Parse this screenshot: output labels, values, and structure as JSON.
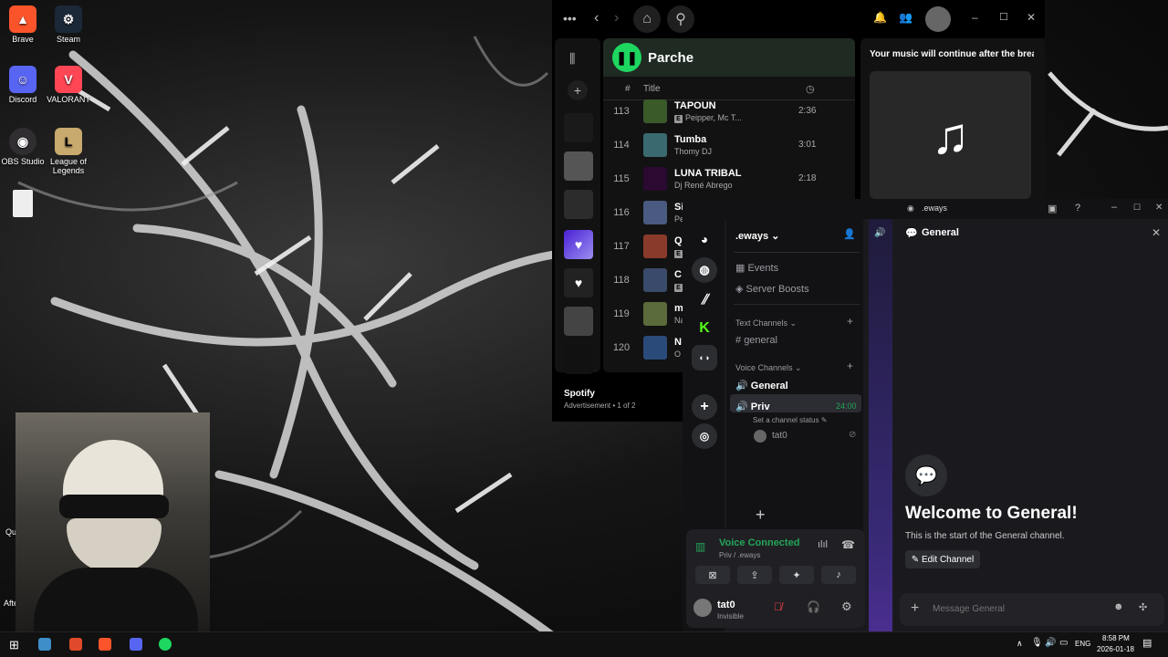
{
  "desktop": {
    "icons": [
      {
        "label": "Brave",
        "icon": "brave-icon",
        "color": "#fb542b"
      },
      {
        "label": "Steam",
        "icon": "steam-icon",
        "color": "#1b2838"
      },
      {
        "label": "Discord",
        "icon": "discord-icon",
        "color": "#5865f2"
      },
      {
        "label": "VALORANT",
        "icon": "valorant-icon",
        "color": "#ff4655"
      },
      {
        "label": "OBS Studio",
        "icon": "obs-icon",
        "color": "#302e31"
      },
      {
        "label": "League of Legends",
        "icon": "league-icon",
        "color": "#c8aa6e"
      },
      {
        "label": "",
        "icon": "file-icon",
        "color": "#eeeeee"
      }
    ],
    "partial_labels": {
      "qu": "Qu",
      "afte": "Afte"
    }
  },
  "spotify": {
    "playlist_title": "Parche",
    "columns": {
      "index": "#",
      "title": "Title"
    },
    "tracks": [
      {
        "num": "113",
        "title": "TAPOUN",
        "artist": "Peipper, Mc T...",
        "duration": "2:36",
        "explicit": true,
        "cover": "#3a5a2a"
      },
      {
        "num": "114",
        "title": "Tumba",
        "artist": "Thomy DJ",
        "duration": "3:01",
        "explicit": false,
        "cover": "#3a6a70"
      },
      {
        "num": "115",
        "title": "LUNA TRIBAL",
        "artist": "Dj René Abrego",
        "duration": "2:18",
        "explicit": false,
        "cover": "#2a0a30"
      },
      {
        "num": "116",
        "title": "Si",
        "artist": "Pe",
        "duration": "",
        "explicit": false,
        "cover": "#4a5a80"
      },
      {
        "num": "117",
        "title": "Q",
        "artist": "",
        "duration": "",
        "explicit": true,
        "cover": "#8a3a2a"
      },
      {
        "num": "118",
        "title": "C",
        "artist": "",
        "duration": "",
        "explicit": true,
        "cover": "#3a4a6a"
      },
      {
        "num": "119",
        "title": "m",
        "artist": "Na",
        "duration": "",
        "explicit": false,
        "cover": "#5a6a3a"
      },
      {
        "num": "120",
        "title": "N",
        "artist": "O",
        "duration": "",
        "explicit": false,
        "cover": "#2a4a7a"
      }
    ],
    "ad_title": "Your music will continue after the break",
    "footer_name": "Spotify",
    "footer_ad": "Advertisement • 1 of 2",
    "accent": "#1ed760"
  },
  "discord": {
    "window_title": ".eways",
    "server_name": ".eways",
    "menu": {
      "events": "Events",
      "boosts": "Server Boosts"
    },
    "text_category": "Text Channels",
    "text_channels": [
      "general"
    ],
    "voice_category": "Voice Channels",
    "voice_channels": [
      {
        "name": "General",
        "selected": true
      },
      {
        "name": "Priv",
        "timer": "24:00",
        "status": "Set a channel status",
        "member": "tat0"
      }
    ],
    "voice_connected": "Voice Connected",
    "voice_location": "Priv / .eways",
    "user_name": "tat0",
    "user_status": "Invisible",
    "chat_header": "General",
    "welcome_title": "Welcome to General!",
    "welcome_sub": "This is the start of the General channel.",
    "edit_channel": "Edit Channel",
    "message_placeholder": "Message General",
    "accent": "#23a559"
  },
  "taskbar": {
    "language": "ENG",
    "time": "8:58 PM",
    "date": "2026-01-18"
  }
}
